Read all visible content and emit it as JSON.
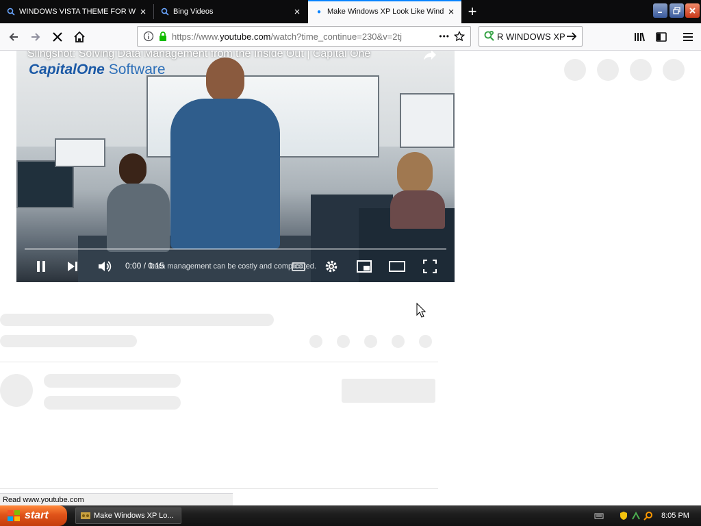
{
  "browser": {
    "tabs": [
      {
        "title": "WINDOWS VISTA THEME FOR WI",
        "active": false
      },
      {
        "title": "Bing Videos",
        "active": false
      },
      {
        "title": "Make Windows XP Look Like Windo",
        "active": true
      }
    ],
    "new_tab_label": "+",
    "close_glyph": "×",
    "url": "https://www.youtube.com/watch?time_continue=230&v=2tj",
    "url_prefix": "https://www.",
    "url_host": "youtube.com",
    "url_rest": "/watch?time_continue=230&v=2tj",
    "page_actions_glyph": "•••",
    "search_text": "R WINDOWS XP",
    "status_text": "Read www.youtube.com"
  },
  "video": {
    "title": "Slingshot: Solving Data Management from the Inside Out | Capital One",
    "brand_name": "Capital",
    "brand_one": "One",
    "brand_suffix": "Software",
    "timecode": "0:00 / 0:15",
    "subtitle": "Data management can be costly and complicated.",
    "progress": 0.0,
    "cc_label": "CC"
  },
  "taskbar": {
    "start_label": "start",
    "task_label": "Make Windows XP Lo...",
    "clock": "8:05 PM"
  },
  "colors": {
    "accent": "#0a84ff",
    "progress_red": "#ff0000",
    "start_orange": "#e0541a",
    "lock_green": "#12bc00"
  },
  "icons": [
    "back-icon",
    "forward-icon",
    "stop-icon",
    "home-icon",
    "info-icon",
    "lock-icon",
    "star-icon",
    "search-icon",
    "arrow-right-icon",
    "library-icon",
    "sidebar-icon",
    "menu-icon",
    "play-pause-icon",
    "next-icon",
    "volume-icon",
    "settings-icon",
    "miniplayer-icon",
    "theater-icon",
    "fullscreen-icon",
    "share-icon"
  ]
}
